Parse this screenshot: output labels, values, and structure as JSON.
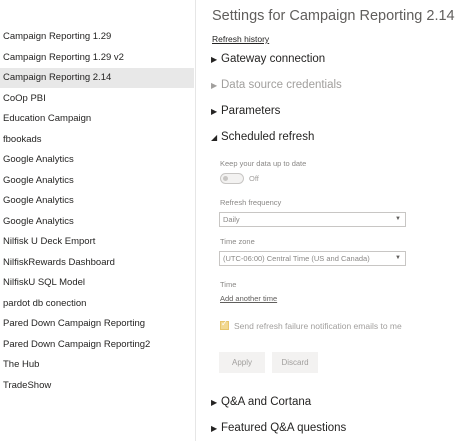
{
  "sidebar": {
    "items": [
      {
        "label": "Campaign Reporting 1.29",
        "selected": false
      },
      {
        "label": "Campaign Reporting 1.29 v2",
        "selected": false
      },
      {
        "label": "Campaign Reporting 2.14",
        "selected": true
      },
      {
        "label": "CoOp PBI",
        "selected": false
      },
      {
        "label": "Education Campaign",
        "selected": false
      },
      {
        "label": "fbookads",
        "selected": false
      },
      {
        "label": "Google Analytics",
        "selected": false
      },
      {
        "label": "Google Analytics",
        "selected": false
      },
      {
        "label": "Google Analytics",
        "selected": false
      },
      {
        "label": "Google Analytics",
        "selected": false
      },
      {
        "label": "Nilfisk U Deck Emport",
        "selected": false
      },
      {
        "label": "NilfiskRewards Dashboard",
        "selected": false
      },
      {
        "label": "NilfiskU SQL Model",
        "selected": false
      },
      {
        "label": "pardot db conection",
        "selected": false
      },
      {
        "label": "Pared Down Campaign Reporting",
        "selected": false
      },
      {
        "label": "Pared Down Campaign Reporting2",
        "selected": false
      },
      {
        "label": "The Hub",
        "selected": false
      },
      {
        "label": "TradeShow",
        "selected": false
      }
    ]
  },
  "main": {
    "title": "Settings for Campaign Reporting 2.14",
    "refresh_history": "Refresh history",
    "sections": {
      "gateway": "Gateway connection",
      "credentials": "Data source credentials",
      "parameters": "Parameters",
      "scheduled": "Scheduled refresh",
      "qna": "Q&A and Cortana",
      "featured": "Featured Q&A questions"
    },
    "scheduled_refresh": {
      "keep_updated_label": "Keep your data up to date",
      "toggle_state": "Off",
      "frequency_label": "Refresh frequency",
      "frequency_value": "Daily",
      "timezone_label": "Time zone",
      "timezone_value": "(UTC-06:00) Central Time (US and Canada)",
      "time_label": "Time",
      "add_time": "Add another time",
      "notify_label": "Send refresh failure notification emails to me",
      "notify_checked": true
    },
    "buttons": {
      "apply": "Apply",
      "discard": "Discard"
    }
  },
  "colors": {
    "selected_row": "#e8e8e8",
    "checkbox_fill": "#f2d891",
    "muted_text": "#a19f9d"
  }
}
